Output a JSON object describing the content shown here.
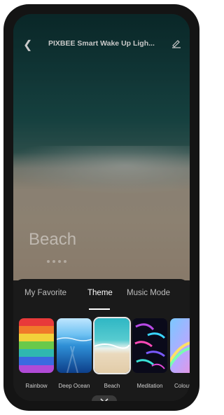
{
  "header": {
    "title": "PIXBEE Smart Wake Up Ligh..."
  },
  "hero": {
    "theme_name": "Beach",
    "pager_count": 4
  },
  "tabs": [
    {
      "label": "My Favorite",
      "active": false
    },
    {
      "label": "Theme",
      "active": true
    },
    {
      "label": "Music Mode",
      "active": false
    }
  ],
  "themes": [
    {
      "label": "Rainbow",
      "selected": false
    },
    {
      "label": "Deep Ocean",
      "selected": false
    },
    {
      "label": "Beach",
      "selected": true
    },
    {
      "label": "Meditation",
      "selected": false
    },
    {
      "label": "Colour",
      "selected": false
    }
  ],
  "icons": {
    "back": "chevron-left-icon",
    "edit": "pencil-icon",
    "collapse": "chevron-down-icon"
  }
}
